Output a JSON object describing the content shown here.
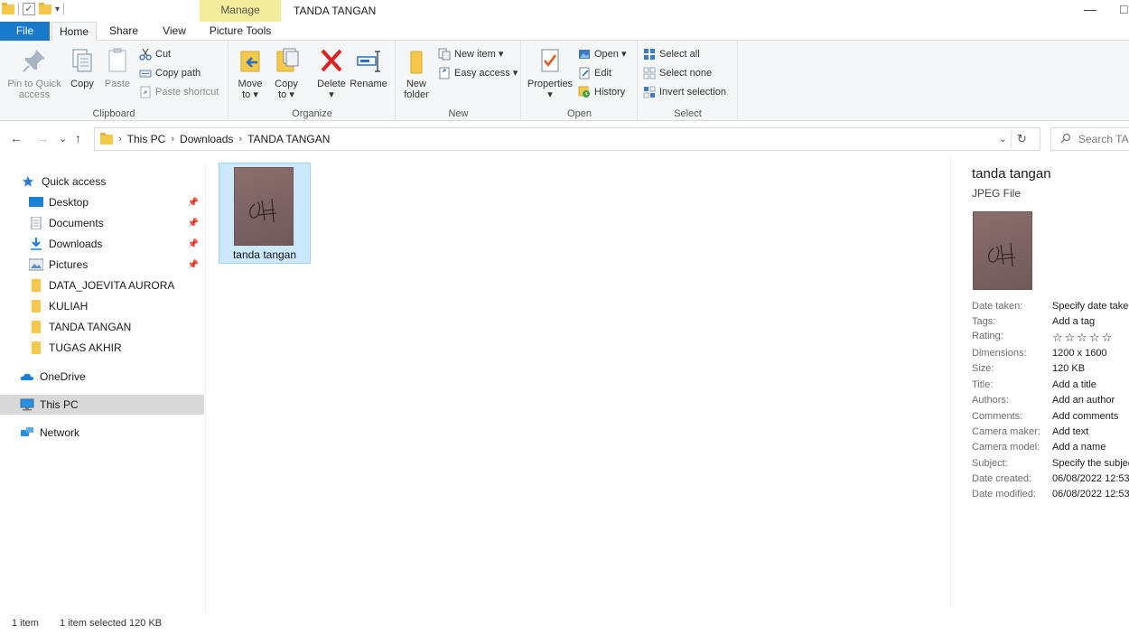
{
  "titlebar": {
    "manage_tab": "Manage",
    "window_title": "TANDA TANGAN",
    "minimize": "—",
    "maximize": "□"
  },
  "tabs": {
    "file": "File",
    "home": "Home",
    "share": "Share",
    "view": "View",
    "picture_tools": "Picture Tools"
  },
  "ribbon": {
    "clipboard": {
      "label": "Clipboard",
      "pin_line1": "Pin to Quick",
      "pin_line2": "access",
      "copy": "Copy",
      "paste": "Paste",
      "cut": "Cut",
      "copy_path": "Copy path",
      "paste_shortcut": "Paste shortcut"
    },
    "organize": {
      "label": "Organize",
      "move_line1": "Move",
      "move_line2": "to ▾",
      "copy_line1": "Copy",
      "copy_line2": "to ▾",
      "delete": "Delete",
      "delete_arrow": "▾",
      "rename": "Rename"
    },
    "new": {
      "label": "New",
      "new_folder_line1": "New",
      "new_folder_line2": "folder",
      "new_item": "New item ▾",
      "easy_access": "Easy access ▾"
    },
    "open": {
      "label": "Open",
      "properties": "Properties",
      "properties_arrow": "▾",
      "open": "Open ▾",
      "edit": "Edit",
      "history": "History"
    },
    "select": {
      "label": "Select",
      "select_all": "Select all",
      "select_none": "Select none",
      "invert_selection": "Invert selection"
    }
  },
  "address": {
    "back": "←",
    "forward": "→",
    "recent": "⌄",
    "up": "↑",
    "crumbs": [
      "This PC",
      "Downloads",
      "TANDA TANGAN"
    ],
    "sep": "›",
    "dropdown": "⌄",
    "refresh": "↻",
    "search_placeholder": "Search TANDA TANGAN"
  },
  "nav": {
    "quick_access": "Quick access",
    "desktop": "Desktop",
    "documents": "Documents",
    "downloads": "Downloads",
    "pictures": "Pictures",
    "data_joevita": "DATA_JOEVITA AURORA",
    "kuliah": "KULIAH",
    "tanda_tangan": "TANDA TANGAN",
    "tugas_akhir": "TUGAS AKHIR",
    "onedrive": "OneDrive",
    "this_pc": "This PC",
    "network": "Network",
    "pin_glyph": "📌"
  },
  "content": {
    "file_name": "tanda tangan"
  },
  "details": {
    "title": "tanda tangan",
    "type": "JPEG File",
    "props": [
      {
        "k": "Date taken:",
        "v": "Specify date taken"
      },
      {
        "k": "Tags:",
        "v": "Add a tag"
      },
      {
        "k": "Rating:",
        "v": "☆☆☆☆☆"
      },
      {
        "k": "Dimensions:",
        "v": "1200 x 1600"
      },
      {
        "k": "Size:",
        "v": "120 KB"
      },
      {
        "k": "Title:",
        "v": "Add a title"
      },
      {
        "k": "Authors:",
        "v": "Add an author"
      },
      {
        "k": "Comments:",
        "v": "Add comments"
      },
      {
        "k": "Camera maker:",
        "v": "Add text"
      },
      {
        "k": "Camera model:",
        "v": "Add a name"
      },
      {
        "k": "Subject:",
        "v": "Specify the subject"
      },
      {
        "k": "Date created:",
        "v": "06/08/2022 12:53"
      },
      {
        "k": "Date modified:",
        "v": "06/08/2022 12:53"
      }
    ]
  },
  "status": {
    "count": "1 item",
    "selected": "1 item selected  120 KB"
  },
  "colors": {
    "file_tab": "#1979ca",
    "manage_tab": "#f3ec9a",
    "selection": "#cce8ff",
    "folder": "#f4c84a"
  }
}
